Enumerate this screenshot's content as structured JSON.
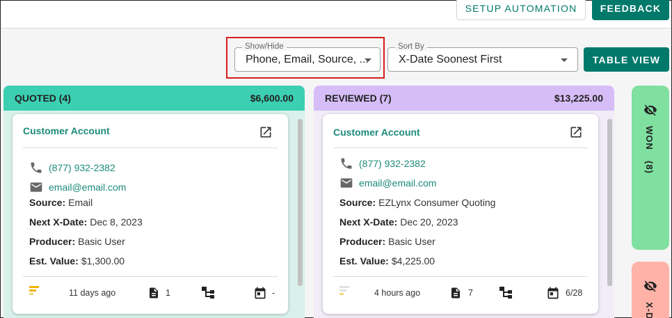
{
  "toolbar": {
    "setup_automation_label": "SETUP AUTOMATION",
    "feedback_label": "FEEDBACK",
    "table_view_label": "TABLE VIEW"
  },
  "filters": {
    "show_hide": {
      "label": "Show/Hide",
      "value": "Phone, Email, Source, ..."
    },
    "sort_by": {
      "label": "Sort By",
      "value": "X-Date Soonest First"
    }
  },
  "columns": [
    {
      "title": "QUOTED (4)",
      "total": "$6,600.00",
      "header_color": "#3ccfb2",
      "body_color": "#d9f1eb",
      "card": {
        "title": "Customer Account",
        "phone": "(877) 932-2382",
        "email": "email@email.com",
        "source_label": "Source:",
        "source": "Email",
        "xdate_label": "Next X-Date:",
        "xdate": "Dec 8, 2023",
        "producer_label": "Producer:",
        "producer": "Basic User",
        "est_label": "Est. Value:",
        "est": "$1,300.00",
        "time_ago": "11 days ago",
        "docs": "1",
        "tasks": "-"
      }
    },
    {
      "title": "REVIEWED (7)",
      "total": "$13,225.00",
      "header_color": "#d6bdf7",
      "body_color": "#f1ecf7",
      "card": {
        "title": "Customer Account",
        "phone": "(877) 932-2382",
        "email": "email@email.com",
        "source_label": "Source:",
        "source": "EZLynx Consumer Quoting",
        "xdate_label": "Next X-Date:",
        "xdate": "Dec 20, 2023",
        "producer_label": "Producer:",
        "producer": "Basic User",
        "est_label": "Est. Value:",
        "est": "$4,225.00",
        "time_ago": "4 hours ago",
        "docs": "7",
        "tasks": "6/28"
      }
    }
  ],
  "side_columns": [
    {
      "title": "WON",
      "count": "(8)",
      "color": "#7fe0a0"
    },
    {
      "title": "X-D",
      "color": "#ffb3a8"
    }
  ],
  "icons": {
    "phone": "phone-icon",
    "email": "email-icon",
    "open": "open-in-new-icon",
    "priority": "priority-bars-icon",
    "document": "document-icon",
    "hierarchy": "hierarchy-icon",
    "calendar": "calendar-icon",
    "hidden": "eye-off-icon"
  }
}
